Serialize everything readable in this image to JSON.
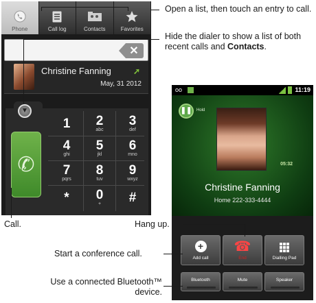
{
  "dialer": {
    "tabs": [
      {
        "label": "Phone",
        "icon": "phone-icon",
        "active": true
      },
      {
        "label": "Call log",
        "icon": "list-icon",
        "active": false
      },
      {
        "label": "Contacts",
        "icon": "contacts-icon",
        "active": false
      },
      {
        "label": "Favorites",
        "icon": "star-icon",
        "active": false
      }
    ],
    "number_value": "",
    "recent_call": {
      "name": "Christine Fanning",
      "date": "May, 31 2012"
    },
    "keys": [
      {
        "digit": "1",
        "letters": ""
      },
      {
        "digit": "2",
        "letters": "abc"
      },
      {
        "digit": "3",
        "letters": "def"
      },
      {
        "digit": "4",
        "letters": "ghi"
      },
      {
        "digit": "5",
        "letters": "jkl"
      },
      {
        "digit": "6",
        "letters": "mno"
      },
      {
        "digit": "7",
        "letters": "pqrs"
      },
      {
        "digit": "8",
        "letters": "tuv"
      },
      {
        "digit": "9",
        "letters": "wxyz"
      },
      {
        "digit": "*",
        "letters": ""
      },
      {
        "digit": "0",
        "letters": "+"
      },
      {
        "digit": "#",
        "letters": ""
      }
    ]
  },
  "incall": {
    "status": {
      "time": "11:19",
      "voicemail_icon": "voicemail-icon"
    },
    "hold_label": "Hold",
    "timer": "05:32",
    "caller_name": "Christine Fanning",
    "caller_number": "Home 222-333-4444",
    "buttons": {
      "add_call": "Add call",
      "end": "End",
      "dialpad": "Dialling Pad",
      "bluetooth": "Bluetooth",
      "mute": "Mute",
      "speaker": "Speaker"
    }
  },
  "callouts": {
    "open_list": "Open a list, then touch an entry to call.",
    "hide_dialer_prefix": "Hide the dialer to show a list of both recent calls and ",
    "hide_dialer_bold": "Contacts",
    "hide_dialer_suffix": ".",
    "call": "Call.",
    "hang_up": "Hang up.",
    "conference": "Start a conference call.",
    "bluetooth_line1": "Use a connected Bluetooth™",
    "bluetooth_line2": "device."
  },
  "colors": {
    "accent_green": "#6fb24a",
    "end_red": "#ff3b30",
    "callout_line": "#1a1a1a"
  }
}
